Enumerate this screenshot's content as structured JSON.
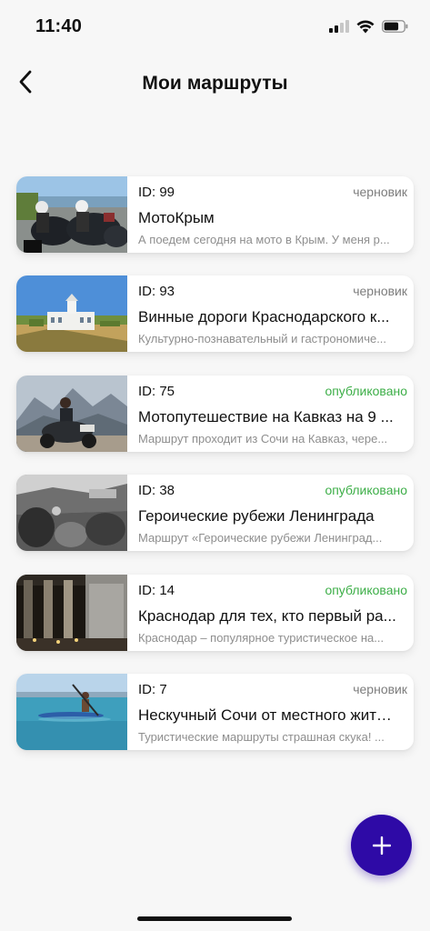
{
  "status_bar": {
    "time": "11:40"
  },
  "header": {
    "title": "Мои маршруты"
  },
  "colors": {
    "accent": "#2e0aa6",
    "status_published": "#3cae47",
    "status_draft": "#7d7d7d"
  },
  "icons": [
    "signal-icon",
    "wifi-icon",
    "battery-icon",
    "back-arrow-icon",
    "plus-icon"
  ],
  "routes": [
    {
      "id_label": "ID: 99",
      "status": "черновик",
      "status_type": "draft",
      "title": "МотоКрым",
      "description": "А поедем сегодня на мото в Крым. У меня р...",
      "thumbnail": "motorcyclists-photo"
    },
    {
      "id_label": "ID: 93",
      "status": "черновик",
      "status_type": "draft",
      "title": "Винные дороги Краснодарского к...",
      "description": "Культурно-познавательный и гастрономиче...",
      "thumbnail": "winery-building-photo"
    },
    {
      "id_label": "ID: 75",
      "status": "опубликовано",
      "status_type": "published",
      "title": "Мотопутешествие на Кавказ на 9 ...",
      "description": "Маршрут проходит из Сочи на Кавказ, чере...",
      "thumbnail": "mountain-motorcycle-photo"
    },
    {
      "id_label": "ID: 38",
      "status": "опубликовано",
      "status_type": "published",
      "title": "Героические рубежи Ленинграда",
      "description": "Маршрут «Героические рубежи Ленинград...",
      "thumbnail": "war-memorial-photo"
    },
    {
      "id_label": "ID: 14",
      "status": "опубликовано",
      "status_type": "published",
      "title": "Краснодар для тех, кто первый ра...",
      "description": "Краснодар – популярное туристическое на...",
      "thumbnail": "colonnade-night-photo"
    },
    {
      "id_label": "ID: 7",
      "status": "черновик",
      "status_type": "draft",
      "title": "Нескучный Сочи от местного жите...",
      "description": "Туристические маршруты страшная скука! ...",
      "thumbnail": "sea-kayak-photo"
    }
  ]
}
